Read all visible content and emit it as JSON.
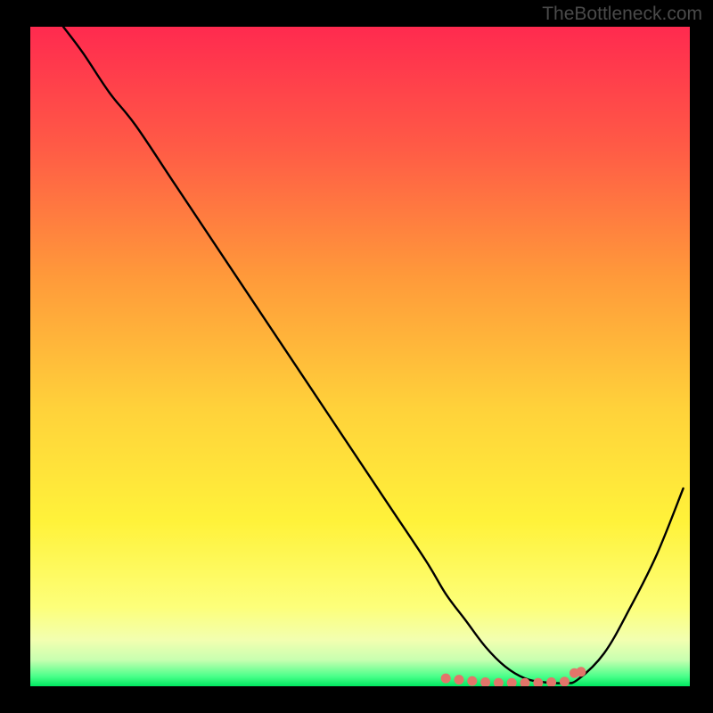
{
  "watermark": "TheBottleneck.com",
  "chart_data": {
    "type": "line",
    "title": "",
    "xlabel": "",
    "ylabel": "",
    "xlim": [
      0,
      100
    ],
    "ylim": [
      0,
      100
    ],
    "series": [
      {
        "name": "curve",
        "x": [
          5,
          8,
          12,
          16,
          22,
          30,
          38,
          46,
          54,
          60,
          63,
          66,
          69,
          72,
          75,
          78,
          81,
          83,
          87,
          91,
          95,
          99
        ],
        "y": [
          100,
          96,
          90,
          85,
          76,
          64,
          52,
          40,
          28,
          19,
          14,
          10,
          6,
          3,
          1.2,
          0.6,
          0.5,
          1,
          5,
          12,
          20,
          30
        ]
      }
    ],
    "markers": {
      "name": "highlight-points",
      "x": [
        63,
        65,
        67,
        69,
        71,
        73,
        75,
        77,
        79,
        81,
        82.5,
        83.5
      ],
      "y": [
        1.2,
        1.0,
        0.8,
        0.6,
        0.5,
        0.5,
        0.5,
        0.5,
        0.6,
        0.7,
        2.0,
        2.2
      ],
      "color": "#e2756a"
    },
    "gradient_stops": [
      {
        "offset": 0,
        "color": "#ff2a4f"
      },
      {
        "offset": 18,
        "color": "#ff5a46"
      },
      {
        "offset": 38,
        "color": "#ff9a3a"
      },
      {
        "offset": 58,
        "color": "#ffd23a"
      },
      {
        "offset": 75,
        "color": "#fff23a"
      },
      {
        "offset": 88,
        "color": "#fdff7a"
      },
      {
        "offset": 93,
        "color": "#f2ffb0"
      },
      {
        "offset": 96,
        "color": "#c8ffb0"
      },
      {
        "offset": 98.5,
        "color": "#4aff8a"
      },
      {
        "offset": 100,
        "color": "#00e860"
      }
    ]
  }
}
